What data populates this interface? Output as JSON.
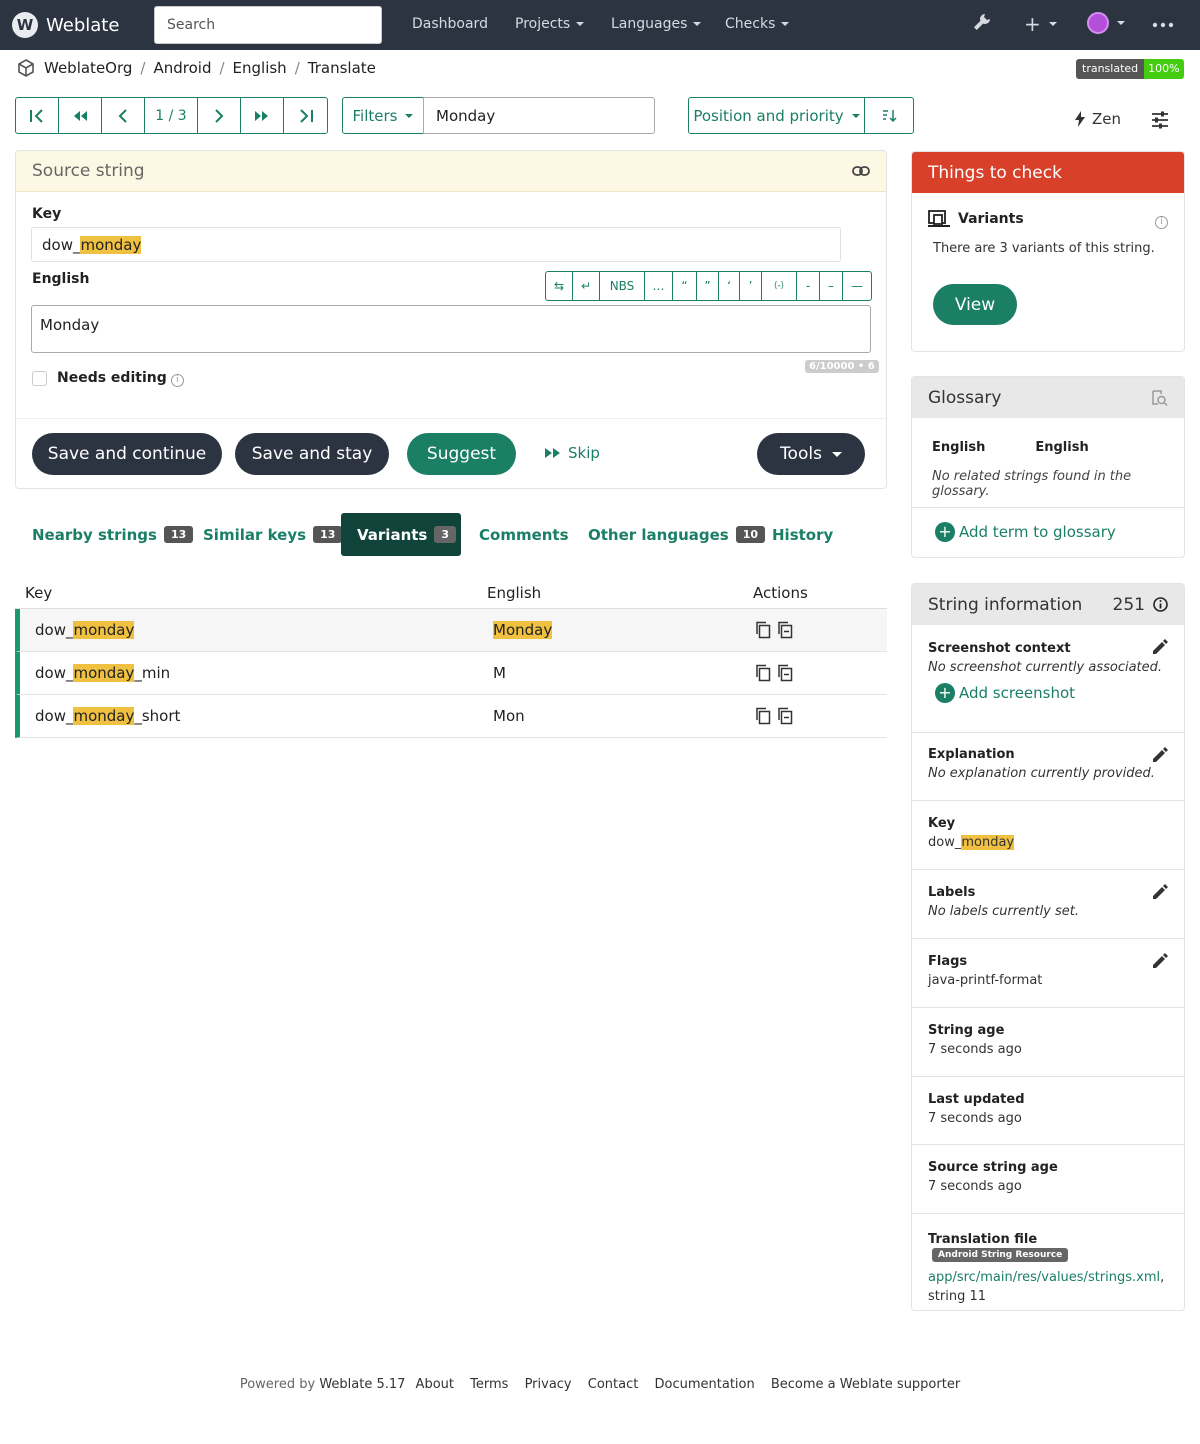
{
  "navbar": {
    "brand": "Weblate",
    "search_placeholder": "Search",
    "items": [
      "Dashboard",
      "Projects",
      "Languages",
      "Checks"
    ]
  },
  "breadcrumb": [
    "WeblateOrg",
    "Android",
    "English",
    "Translate"
  ],
  "status": {
    "label": "translated",
    "percent": "100%"
  },
  "toolbar": {
    "position": "1 / 3",
    "filters_label": "Filters",
    "filter_value": "Monday",
    "sort_label": "Position and priority",
    "zen_label": "Zen"
  },
  "source": {
    "header": "Source string",
    "key_label": "Key",
    "key_prefix": "dow_",
    "key_highlight": "monday",
    "lang_label": "English",
    "special_chars": [
      "NBS",
      "…",
      "“",
      "”",
      "‘",
      "’",
      "⟨-⟩",
      "‐",
      "–",
      "—"
    ],
    "text": "Monday",
    "counter": "6/10000 • 6",
    "needs_editing": "Needs editing",
    "buttons": {
      "save_continue": "Save and continue",
      "save_stay": "Save and stay",
      "suggest": "Suggest",
      "skip": "Skip",
      "tools": "Tools"
    }
  },
  "tabs": [
    {
      "label": "Nearby strings",
      "count": "13"
    },
    {
      "label": "Similar keys",
      "count": "13"
    },
    {
      "label": "Variants",
      "count": "3"
    },
    {
      "label": "Comments"
    },
    {
      "label": "Other languages",
      "count": "10"
    },
    {
      "label": "History"
    }
  ],
  "variants_table": {
    "headers": [
      "Key",
      "English",
      "Actions"
    ],
    "rows": [
      {
        "key_prefix": "dow_",
        "key_hl": "monday",
        "key_suffix": "",
        "english": "Monday"
      },
      {
        "key_prefix": "dow_",
        "key_hl": "monday",
        "key_suffix": "_min",
        "english": "M"
      },
      {
        "key_prefix": "dow_",
        "key_hl": "monday",
        "key_suffix": "_short",
        "english": "Mon"
      }
    ]
  },
  "checks": {
    "header": "Things to check",
    "title": "Variants",
    "description": "There are 3 variants of this string.",
    "view_label": "View"
  },
  "glossary": {
    "header": "Glossary",
    "col_source": "English",
    "col_target": "English",
    "empty": "No related strings found in the glossary.",
    "add_label": "Add term to glossary"
  },
  "string_info": {
    "header": "String information",
    "id": "251",
    "screenshot_title": "Screenshot context",
    "screenshot_value": "No screenshot currently associated.",
    "add_screenshot": "Add screenshot",
    "explanation_title": "Explanation",
    "explanation_value": "No explanation currently provided.",
    "key_title": "Key",
    "key_prefix": "dow_",
    "key_hl": "monday",
    "labels_title": "Labels",
    "labels_value": "No labels currently set.",
    "flags_title": "Flags",
    "flags_value": "java-printf-format",
    "age_title": "String age",
    "age_value": "7 seconds ago",
    "updated_title": "Last updated",
    "updated_value": "7 seconds ago",
    "source_age_title": "Source string age",
    "source_age_value": "7 seconds ago",
    "file_title": "Translation file",
    "file_badge": "Android String Resource",
    "file_path": "app/src/main/res/values/strings.xml",
    "file_suffix": ",",
    "file_string": "string 11"
  },
  "footer": {
    "powered_prefix": "Powered by",
    "powered_link": "Weblate 5.17",
    "links": [
      "About",
      "Terms",
      "Privacy",
      "Contact",
      "Documentation",
      "Become a Weblate supporter"
    ]
  }
}
